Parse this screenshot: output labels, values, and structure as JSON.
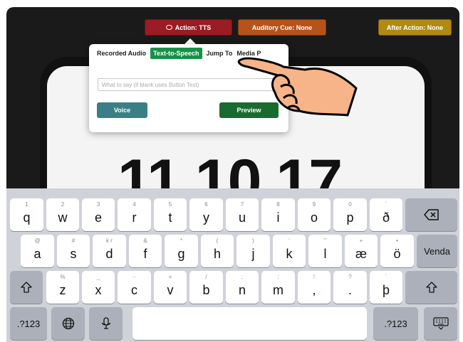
{
  "toolbar": {
    "action_label": "Action: TTS",
    "cue_label": "Auditory Cue: None",
    "after_label": "After Action: None"
  },
  "popover": {
    "tabs": [
      {
        "label": "Recorded Audio",
        "active": false
      },
      {
        "label": "Text-to-Speech",
        "active": true
      },
      {
        "label": "Jump To",
        "active": false
      },
      {
        "label": "Media P",
        "active": false
      }
    ],
    "input_placeholder": "What to say (if blank uses Button Text)",
    "voice_label": "Voice",
    "preview_label": "Preview"
  },
  "display": {
    "time_text": "11 10 17"
  },
  "keyboard": {
    "row1": [
      {
        "main": "q",
        "sub": "1"
      },
      {
        "main": "w",
        "sub": "2"
      },
      {
        "main": "e",
        "sub": "3"
      },
      {
        "main": "r",
        "sub": "4"
      },
      {
        "main": "t",
        "sub": "5"
      },
      {
        "main": "y",
        "sub": "6"
      },
      {
        "main": "u",
        "sub": "7"
      },
      {
        "main": "i",
        "sub": "8"
      },
      {
        "main": "o",
        "sub": "9"
      },
      {
        "main": "p",
        "sub": "0"
      },
      {
        "main": "ð",
        "sub": "´"
      }
    ],
    "row2": [
      {
        "main": "a",
        "sub": "@"
      },
      {
        "main": "s",
        "sub": "#"
      },
      {
        "main": "d",
        "sub": "k r"
      },
      {
        "main": "f",
        "sub": "&"
      },
      {
        "main": "g",
        "sub": "*"
      },
      {
        "main": "h",
        "sub": "("
      },
      {
        "main": "j",
        "sub": ")"
      },
      {
        "main": "k",
        "sub": "'"
      },
      {
        "main": "l",
        "sub": "\""
      },
      {
        "main": "æ",
        "sub": "+"
      },
      {
        "main": "ö",
        "sub": "•"
      }
    ],
    "row3": [
      {
        "main": "z",
        "sub": "%"
      },
      {
        "main": "x",
        "sub": "_"
      },
      {
        "main": "c",
        "sub": "-"
      },
      {
        "main": "v",
        "sub": "="
      },
      {
        "main": "b",
        "sub": "/"
      },
      {
        "main": "n",
        "sub": ";"
      },
      {
        "main": "m",
        "sub": ":"
      },
      {
        "main": ",",
        "sub": "!"
      },
      {
        "main": ".",
        "sub": "?"
      },
      {
        "main": "þ",
        "sub": "´"
      }
    ],
    "return_label": "Venda",
    "numbers_label": ".?123",
    "numbers_label_right": ".?123",
    "backspace_icon": "backspace-icon",
    "shift_icon": "shift-icon",
    "globe_icon": "globe-icon",
    "mic_icon": "microphone-icon",
    "hide_icon": "keyboard-hide-icon"
  }
}
